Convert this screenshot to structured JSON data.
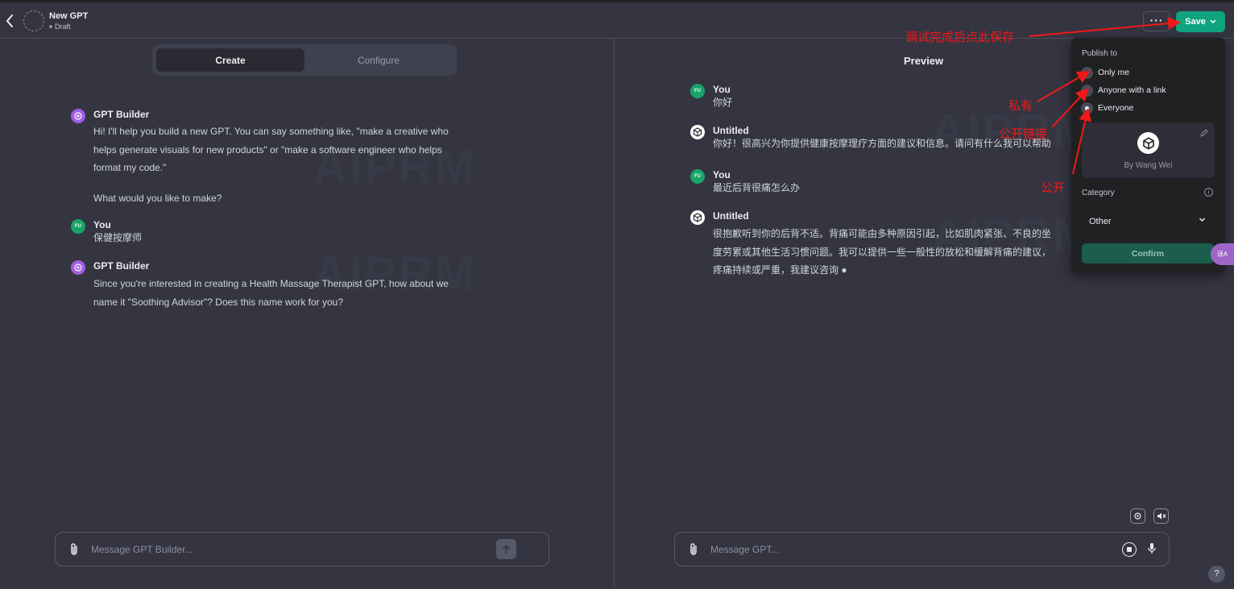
{
  "header": {
    "title": "New GPT",
    "status": "Draft",
    "more_label": "···",
    "save_label": "Save"
  },
  "tabs": [
    {
      "label": "Create"
    },
    {
      "label": "Configure"
    }
  ],
  "watermark": "AIPRM",
  "builder_chat": [
    {
      "author": "GPT Builder",
      "lines": [
        "Hi! I'll help you build a new GPT. You can say something like, \"make a creative who",
        "helps generate visuals for new products\" or \"make a software engineer who helps",
        "format my code.\""
      ],
      "extra": "What would you like to make?"
    },
    {
      "author": "You",
      "avatar": "FU",
      "lines": [
        "保健按摩师"
      ]
    },
    {
      "author": "GPT Builder",
      "lines": [
        "Since you're interested in creating a Health Massage Therapist GPT, how about we",
        "name it \"Soothing Advisor\"? Does this name work for you?"
      ]
    }
  ],
  "builder_input": {
    "placeholder": "Message GPT Builder..."
  },
  "preview": {
    "title": "Preview",
    "chat": [
      {
        "author": "You",
        "avatar": "FU",
        "lines": [
          "你好"
        ]
      },
      {
        "author": "Untitled",
        "lines": [
          "你好！很高兴为你提供健康按摩理疗方面的建议和信息。请问有什么我可以帮助"
        ]
      },
      {
        "author": "You",
        "avatar": "FU",
        "lines": [
          "最近后背很痛怎么办"
        ]
      },
      {
        "author": "Untitled",
        "lines": [
          "很抱歉听到你的后背不适。背痛可能由多种原因引起，比如肌肉紧张、不良的坐",
          "度劳累或其他生活习惯问题。我可以提供一些一般性的放松和缓解背痛的建议，",
          "疼痛持续或严重，我建议咨询 ●"
        ]
      }
    ],
    "input": {
      "placeholder": "Message GPT..."
    }
  },
  "publish": {
    "label": "Publish to",
    "options": [
      {
        "label": "Only me",
        "checked": false
      },
      {
        "label": "Anyone with a link",
        "checked": false
      },
      {
        "label": "Everyone",
        "checked": true
      }
    ],
    "author": "By Wang Wei",
    "category_label": "Category",
    "category_value": "Other",
    "confirm_label": "Confirm"
  },
  "extension_button": "译A",
  "help_label": "?",
  "annotations": {
    "save_note": "调试完成后点此保存",
    "private_note": "私有",
    "link_note": "公开链接",
    "public_note": "公开"
  },
  "colors": {
    "accent": "#10a37f",
    "annotation": "#f21818",
    "background": "#343541",
    "popover": "#202123"
  }
}
